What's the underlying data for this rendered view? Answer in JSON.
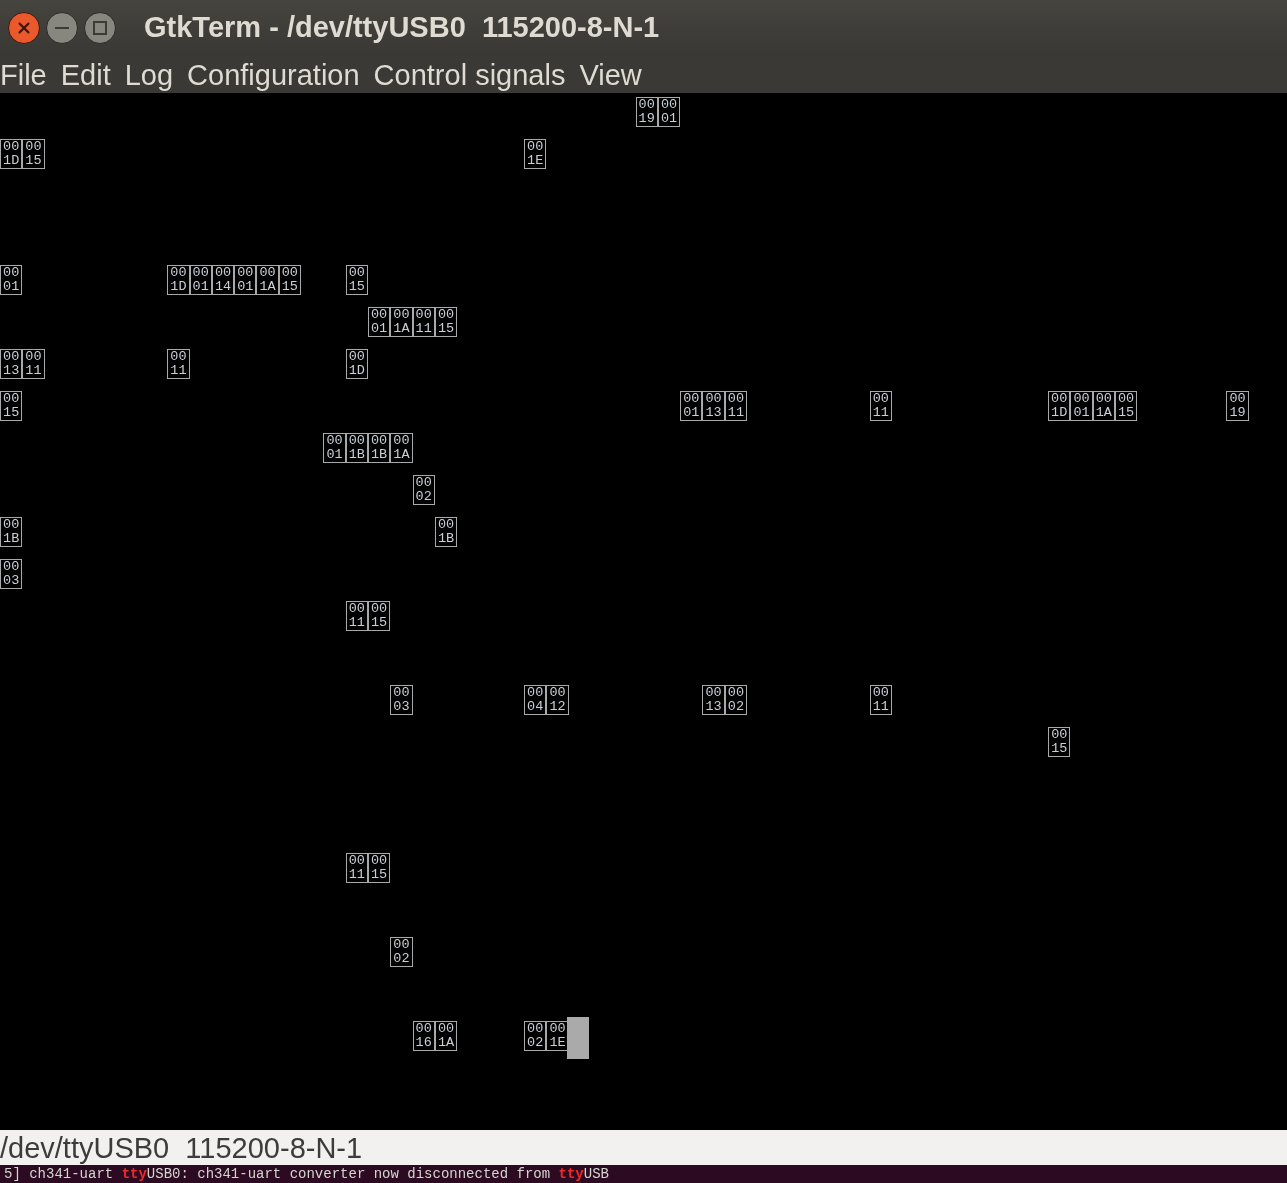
{
  "window": {
    "title": "GtkTerm - /dev/ttyUSB0  115200-8-N-1",
    "buttons": [
      {
        "kind": "close"
      },
      {
        "kind": "minimize"
      },
      {
        "kind": "maximize"
      }
    ]
  },
  "menu": [
    "File",
    "Edit",
    "Log",
    "Configuration",
    "Control signals",
    "View"
  ],
  "terminal": {
    "rows": [
      {
        "runs": [
          {
            "glyphs": [
              "0019",
              "0001"
            ]
          }
        ]
      },
      {
        "runs": [
          {
            "glyphs": [
              "001D",
              "0015"
            ]
          },
          {
            "glyphs": [
              "001E"
            ]
          }
        ]
      },
      {
        "runs": []
      },
      {
        "runs": []
      },
      {
        "runs": [
          {
            "glyphs": [
              "0001"
            ]
          },
          {
            "glyphs": [
              "001D",
              "0001",
              "0014",
              "0001",
              "001A",
              "0015"
            ]
          },
          {
            "glyphs": [
              "0015"
            ]
          }
        ]
      },
      {
        "runs": [
          {
            "glyphs": [
              "0001",
              "001A",
              "0011",
              "0015"
            ]
          }
        ]
      },
      {
        "runs": [
          {
            "glyphs": [
              "0013",
              "0011"
            ]
          },
          {
            "glyphs": [
              "0011"
            ]
          },
          {
            "glyphs": [
              "001D"
            ]
          }
        ]
      },
      {
        "runs": [
          {
            "glyphs": [
              "0015"
            ]
          },
          {
            "glyphs": [
              "0001",
              "0013",
              "0011"
            ]
          },
          {
            "glyphs": [
              "0011"
            ]
          },
          {
            "glyphs": [
              "001D",
              "0001",
              "001A",
              "0015"
            ]
          },
          {
            "glyphs": [
              "0019"
            ]
          }
        ]
      },
      {
        "runs": [
          {
            "glyphs": [
              "0001",
              "001B",
              "001B",
              "001A"
            ]
          }
        ]
      },
      {
        "runs": [
          {
            "glyphs": [
              "0002"
            ]
          }
        ]
      },
      {
        "runs": [
          {
            "glyphs": [
              "001B"
            ]
          },
          {
            "glyphs": [
              "001B"
            ]
          }
        ]
      },
      {
        "runs": [
          {
            "glyphs": [
              "0003"
            ]
          }
        ]
      },
      {
        "runs": [
          {
            "glyphs": [
              "0011",
              "0015"
            ]
          }
        ]
      },
      {
        "runs": []
      },
      {
        "runs": [
          {
            "glyphs": [
              "0003"
            ]
          },
          {
            "glyphs": [
              "0004",
              "0012"
            ]
          },
          {
            "glyphs": [
              "0013",
              "0002"
            ]
          },
          {
            "glyphs": [
              "0011"
            ]
          }
        ]
      },
      {
        "runs": [
          {
            "glyphs": [
              "0015"
            ]
          }
        ]
      },
      {
        "runs": []
      },
      {
        "runs": []
      },
      {
        "runs": [
          {
            "glyphs": [
              "0011",
              "0015"
            ]
          }
        ]
      },
      {
        "runs": []
      },
      {
        "runs": [
          {
            "glyphs": [
              "0002"
            ]
          }
        ]
      },
      {
        "runs": []
      },
      {
        "runs": [
          {
            "glyphs": [
              "0016",
              "001A"
            ]
          },
          {
            "glyphs": [
              "0002",
              "001E"
            ]
          }
        ],
        "cursor": true
      }
    ]
  },
  "status_bar": "/dev/ttyUSB0  115200-8-N-1",
  "background_terminal": [
    {
      "text": "5] ch341-uart ",
      "highlight": false
    },
    {
      "text": "tty",
      "highlight": true
    },
    {
      "text": "USB0: ch341-uart converter now disconnected from ",
      "highlight": false
    },
    {
      "text": "tty",
      "highlight": true
    },
    {
      "text": "USB",
      "highlight": false
    }
  ]
}
